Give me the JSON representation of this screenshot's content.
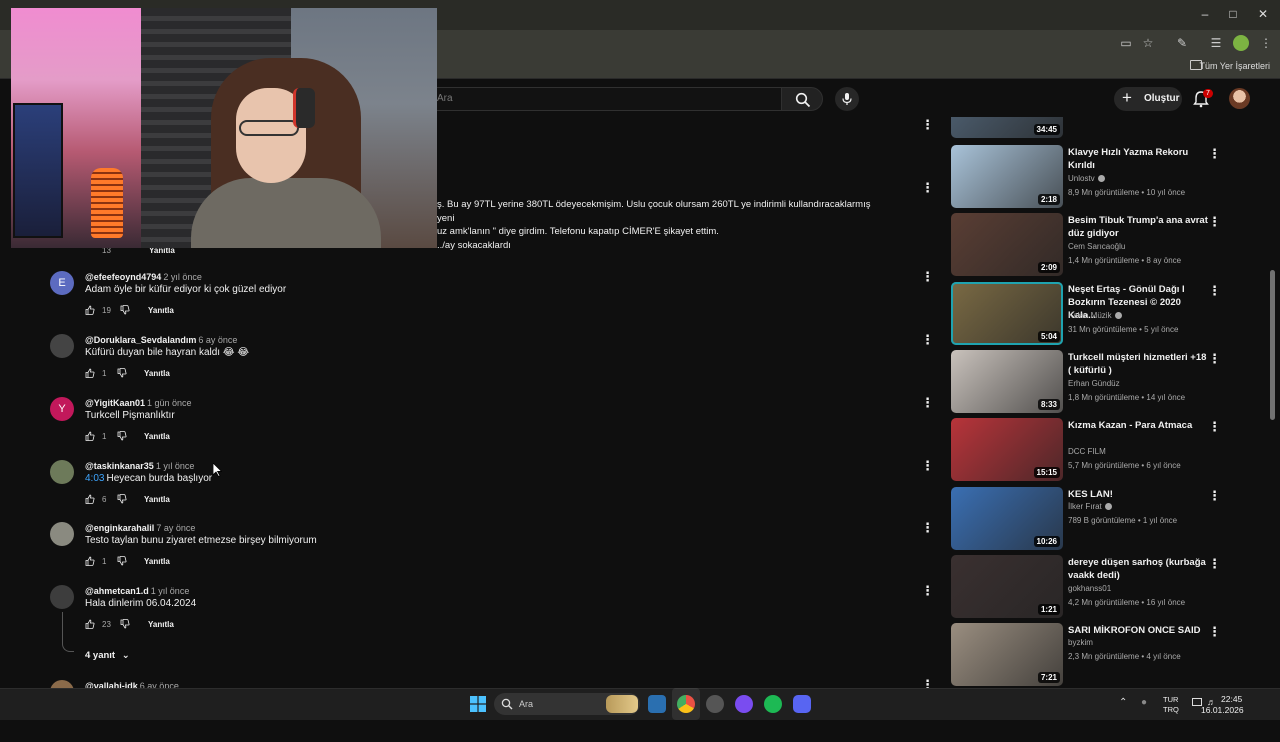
{
  "browser": {
    "bookmarks_label": "Tüm Yer İşaretleri"
  },
  "header": {
    "search_placeholder": "Ara",
    "create_label": "Oluştur",
    "notification_count": "7"
  },
  "partial_comment": {
    "line1": "ş. Bu ay 97TL yerine 380TL ödeyecekmişim. Uslu çocuk olursam 260TL ye indirimli kullandıracaklarmış yeni",
    "line2": "uz amk'lanın \" diye girdim. Telefonu kapatıp CİMER'E şikayet ettim.",
    "line3": "../ay sokacaklardı",
    "likes": "13",
    "reply": "Yanıtla"
  },
  "comments": [
    {
      "author": "@efeefeoynd4794",
      "time": "2 yıl önce",
      "text": "Adam öyle bir küfür ediyor ki çok güzel ediyor",
      "likes": "19",
      "reply": "Yanıtla",
      "avatar_letter": "E",
      "avatar_color": "#5c6bc0"
    },
    {
      "author": "@Doruklara_Sevdalandım",
      "time": "6 ay önce",
      "text": "Küfürü duyan bile hayran kaldı 😂 😂",
      "likes": "1",
      "reply": "Yanıtla",
      "avatar_letter": "",
      "avatar_color": "#444444"
    },
    {
      "author": "@YigitKaan01",
      "time": "1 gün önce",
      "text": "Turkcell Pişmanlıktır",
      "likes": "1",
      "reply": "Yanıtla",
      "avatar_letter": "Y",
      "avatar_color": "#c2185b"
    },
    {
      "author": "@taskinkanar35",
      "time": "1 yıl önce",
      "timestamp_link": "4:03",
      "text": "Heyecan burda başlıyor",
      "likes": "6",
      "reply": "Yanıtla",
      "avatar_letter": "",
      "avatar_color": "#6d7a5a"
    },
    {
      "author": "@enginkarahalil",
      "time": "7 ay önce",
      "text": "Testo taylan bunu ziyaret etmezse birşey bilmiyorum",
      "likes": "1",
      "reply": "Yanıtla",
      "avatar_letter": "",
      "avatar_color": "#8a8a80"
    },
    {
      "author": "@ahmetcan1.d",
      "time": "1 yıl önce",
      "text": "Hala dinlerim 06.04.2024",
      "likes": "23",
      "reply": "Yanıtla",
      "avatar_letter": "",
      "avatar_color": "#3d3d3d"
    },
    {
      "author": "@vallahi-idk",
      "time": "6 ay önce",
      "text": "",
      "likes": "",
      "reply": "",
      "avatar_letter": "",
      "avatar_color": "#8a6a4a"
    }
  ],
  "replies_toggle": "4 yanıt",
  "sidebar": {
    "videos": [
      {
        "title": "",
        "channel": "",
        "meta": "",
        "duration": "34:45",
        "thumb": "#4a5a6a"
      },
      {
        "title": "Klavye Hızlı Yazma Rekoru Kırıldı",
        "channel": "Unlostv",
        "verified": true,
        "meta": "8,9 Mn görüntüleme • 10 yıl önce",
        "duration": "2:18",
        "thumb": "#a9c3d9"
      },
      {
        "title": "Besim Tibuk Trump'a ana avrat düz gidiyor",
        "channel": "Cem Sarıcaoğlu",
        "verified": false,
        "meta": "1,4 Mn görüntüleme • 8 ay önce",
        "duration": "2:09",
        "thumb": "#5a3e34"
      },
      {
        "title": "Neşet Ertaş - Gönül Dağı I Bozkırın Tezenesi © 2020 Kala...",
        "channel": "Kalan Müzik",
        "verified": true,
        "meta": "31 Mn görüntüleme • 5 yıl önce",
        "duration": "5:04",
        "thumb": "#7a6a44"
      },
      {
        "title": "Turkcell müşteri hizmetleri +18 ( küfürlü )",
        "channel": "Erhan Gündüz",
        "verified": false,
        "meta": "1,8 Mn görüntüleme • 14 yıl önce",
        "duration": "8:33",
        "thumb": "#c9c2bc"
      },
      {
        "title": "Kızma Kazan - Para Atmaca",
        "channel": "DCC FILM",
        "verified": false,
        "meta": "5,7 Mn görüntüleme • 6 yıl önce",
        "duration": "15:15",
        "thumb": "#b8343a"
      },
      {
        "title": "KES LAN!",
        "channel": "İlker Fırat",
        "verified": true,
        "meta": "789 B görüntüleme • 1 yıl önce",
        "duration": "10:26",
        "thumb": "#3a6fb3"
      },
      {
        "title": "dereye düşen sarhoş (kurbağa vaakk dedi)",
        "channel": "gokhanss01",
        "verified": false,
        "meta": "4,2 Mn görüntüleme • 16 yıl önce",
        "duration": "1:21",
        "thumb": "#3a3030"
      },
      {
        "title": "SARI MİKROFON ONCE SAID",
        "channel": "byzkim",
        "verified": false,
        "meta": "2,3 Mn görüntüleme • 4 yıl önce",
        "duration": "7:21",
        "thumb": "#9a8e80"
      }
    ]
  },
  "taskbar": {
    "search_label": "Ara",
    "lang_line1": "TUR",
    "lang_line2": "TRQ",
    "time": "22:45",
    "date": "16.01.2026"
  }
}
